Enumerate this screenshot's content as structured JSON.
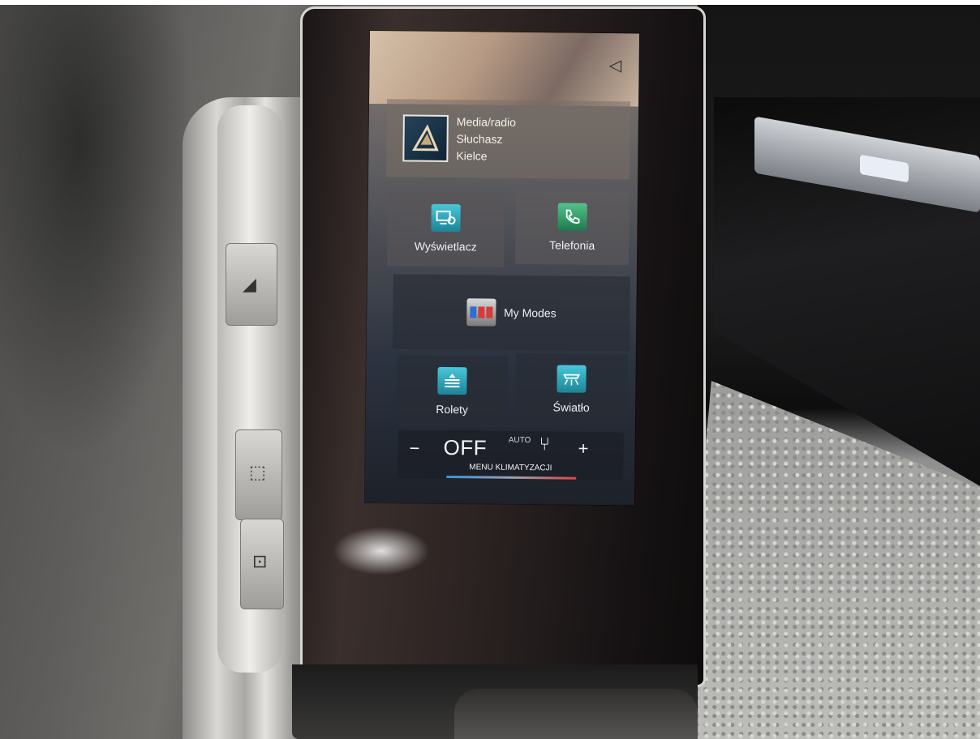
{
  "screen": {
    "speaker": {
      "icon": "speaker-icon"
    },
    "media": {
      "icon": "media-logo-icon",
      "lines": [
        "Media/radio",
        "Słuchasz",
        "Kielce"
      ]
    },
    "tiles": {
      "display": {
        "label": "Wyświetlacz",
        "icon": "display-settings-icon"
      },
      "phone": {
        "label": "Telefonia",
        "icon": "phone-icon"
      },
      "modes": {
        "label": "My Modes",
        "icon": "my-modes-icon"
      },
      "blinds": {
        "label": "Rolety",
        "icon": "blinds-icon"
      },
      "light": {
        "label": "Światło",
        "icon": "light-icon"
      }
    },
    "climate": {
      "minus": "−",
      "value": "OFF",
      "auto": "AUTO",
      "seat_icon": "seat-heating-icon",
      "plus": "+",
      "menu_label": "MENU KLIMATYZACJI"
    }
  },
  "colors": {
    "tile_icon_teal": "#2aa7bd",
    "tile_icon_green": "#2f9a63",
    "climate_bar_cold": "#3f8fe0",
    "climate_bar_hot": "#e0453f"
  }
}
